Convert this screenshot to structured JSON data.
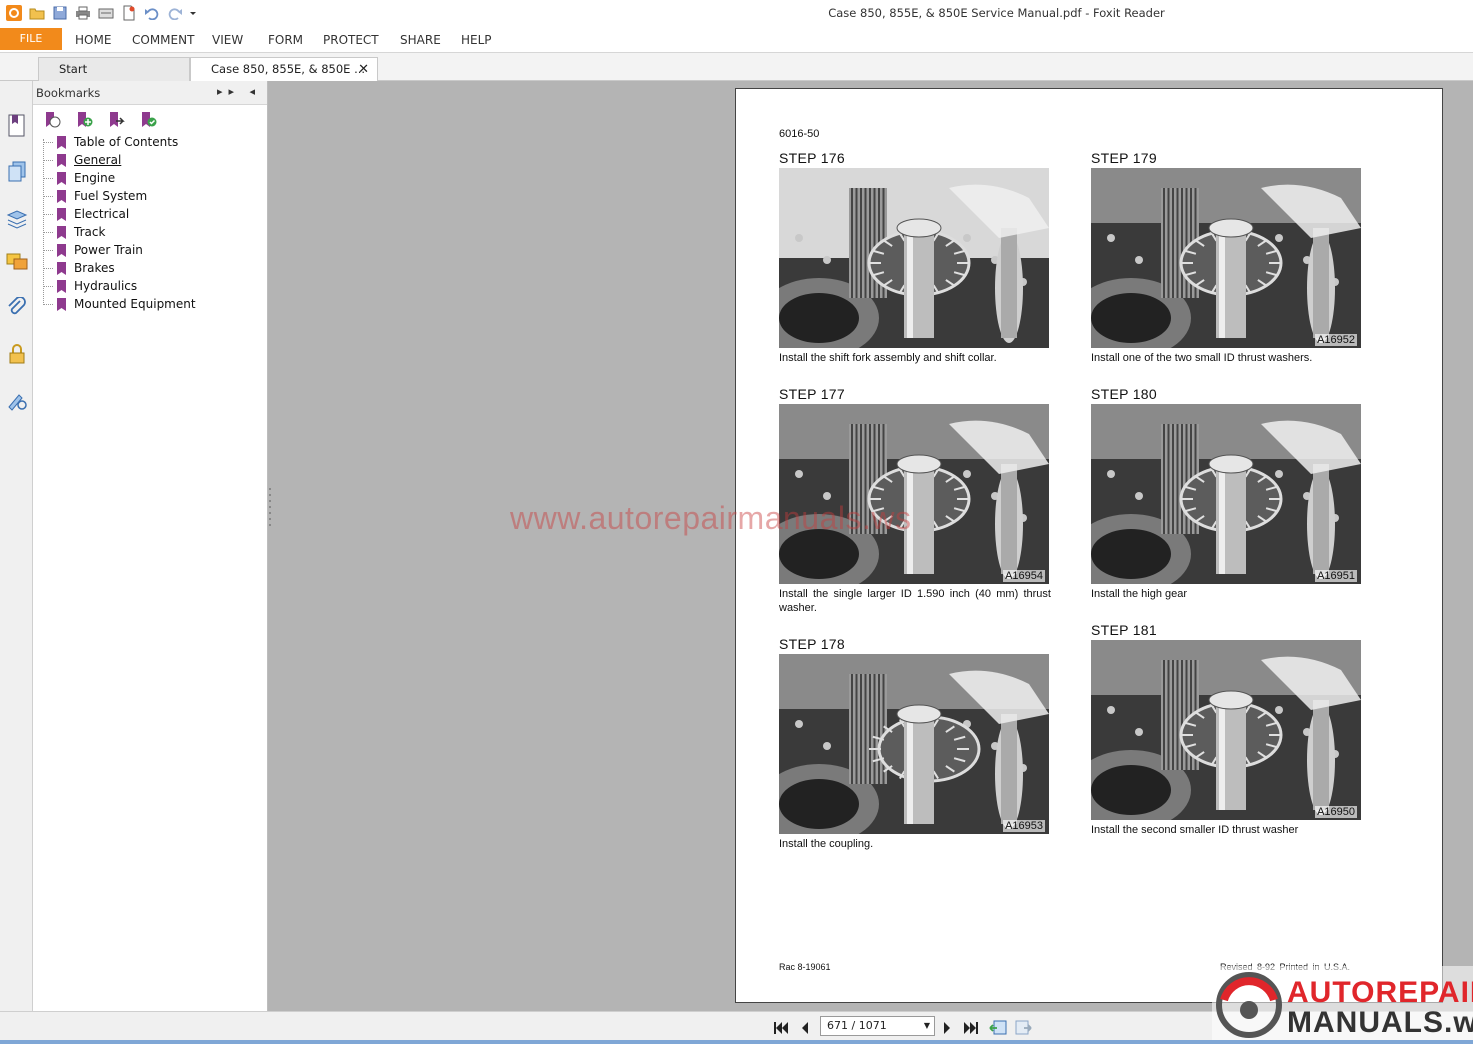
{
  "window": {
    "title": "Case 850, 855E, & 850E Service Manual.pdf - Foxit Reader"
  },
  "menu": {
    "file": "FILE",
    "items": [
      "HOME",
      "COMMENT",
      "VIEW",
      "FORM",
      "PROTECT",
      "SHARE",
      "HELP"
    ]
  },
  "tabs": [
    {
      "label": "Start"
    },
    {
      "label": "Case 850, 855E, & 850E ...",
      "close": "✕"
    }
  ],
  "bookmarks": {
    "title": "Bookmarks",
    "controls": "▸▸ ◂",
    "items": [
      {
        "label": "Table of Contents"
      },
      {
        "label": "General"
      },
      {
        "label": "Engine"
      },
      {
        "label": "Fuel System"
      },
      {
        "label": "Electrical"
      },
      {
        "label": "Track"
      },
      {
        "label": "Power Train"
      },
      {
        "label": "Brakes"
      },
      {
        "label": "Hydraulics"
      },
      {
        "label": "Mounted Equipment"
      }
    ],
    "selected": "General"
  },
  "page": {
    "code": "6016-50",
    "steps": [
      {
        "title": "STEP 176",
        "caption": "Install the shift fork assembly and shift collar.",
        "photo_code": ""
      },
      {
        "title": "STEP 177",
        "caption": "Install the single larger ID 1.590 inch (40 mm) thrust washer.",
        "photo_code": "A16954"
      },
      {
        "title": "STEP 178",
        "caption": "Install the coupling.",
        "photo_code": "A16953"
      },
      {
        "title": "STEP 179",
        "caption": "Install one of the two small ID thrust washers.",
        "photo_code": "A16952"
      },
      {
        "title": "STEP 180",
        "caption": "Install the high gear",
        "photo_code": "A16951"
      },
      {
        "title": "STEP 181",
        "caption": "Install the second smaller ID thrust washer",
        "photo_code": "A16950"
      }
    ],
    "footer_left": "Rac 8-19061",
    "footer_right": "Revised 8-92    Printed in U.S.A."
  },
  "watermark": {
    "text": "www.autorepairmanuals.ws",
    "logo_line1": "AUTOREPAIR",
    "logo_line2": "MANUALS.ws"
  },
  "navigation": {
    "page_indicator": "671 / 1071"
  },
  "colors": {
    "file_button": "#f28a1b",
    "bookmark_flag": "#8e3a8e",
    "doc_background": "#b4b4b4",
    "watermark_red": "#e0262b"
  }
}
